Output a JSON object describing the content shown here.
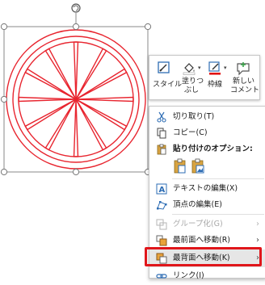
{
  "mini_toolbar": {
    "style_label": "スタイル",
    "fill_label_line1": "塗りつ",
    "fill_label_line2": "ぶし",
    "outline_label": "枠線",
    "new_comment_line1": "新しい",
    "new_comment_line2": "コメント"
  },
  "context_menu": {
    "cut": "切り取り(T)",
    "copy": "コピー(C)",
    "paste_options": "貼り付けのオプション:",
    "edit_text": "テキストの編集(X)",
    "edit_points": "頂点の編集(E)",
    "group": "グループ化(G)",
    "bring_to_front": "最前面へ移動(R)",
    "send_to_back": "最背面へ移動(K)",
    "link": "リンク(I)"
  },
  "colors": {
    "shape_stroke": "#e8252f",
    "highlight_border": "#e0161b",
    "outline_accent": "#e00000",
    "comment_accent": "#3aa34a",
    "icon_blue": "#2e6db4"
  }
}
